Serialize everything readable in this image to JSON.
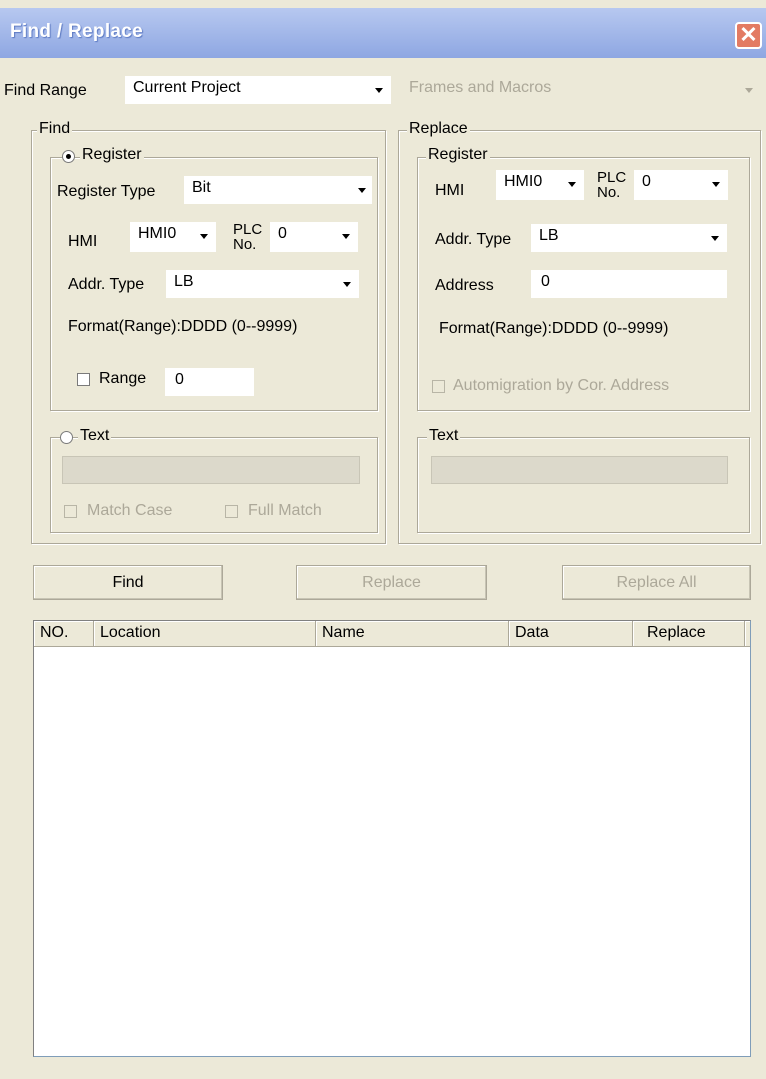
{
  "window": {
    "title": "Find / Replace"
  },
  "find_range": {
    "label": "Find Range",
    "scope": "Current Project",
    "subscope": "Frames and Macros"
  },
  "find": {
    "legend": "Find",
    "register": {
      "option_label": "Register",
      "register_type_label": "Register Type",
      "register_type": "Bit",
      "hmi_label": "HMI",
      "hmi": "HMI0",
      "plc_label_line1": "PLC",
      "plc_label_line2": "No.",
      "plc": "0",
      "addr_type_label": "Addr. Type",
      "addr_type": "LB",
      "format": "Format(Range):DDDD (0--9999)",
      "range_label": "Range",
      "range_value": "0"
    },
    "text": {
      "option_label": "Text",
      "value": "",
      "match_case_label": "Match Case",
      "full_match_label": "Full Match"
    }
  },
  "replace": {
    "legend": "Replace",
    "register": {
      "legend": "Register",
      "hmi_label": "HMI",
      "hmi": "HMI0",
      "plc_label_line1": "PLC",
      "plc_label_line2": "No.",
      "plc": "0",
      "addr_type_label": "Addr. Type",
      "addr_type": "LB",
      "address_label": "Address",
      "address": "0",
      "format": "Format(Range):DDDD (0--9999)",
      "automigration_label": "Automigration by Cor. Address"
    },
    "text": {
      "legend": "Text",
      "value": ""
    }
  },
  "buttons": {
    "find": "Find",
    "replace": "Replace",
    "replace_all": "Replace All"
  },
  "results": {
    "columns": [
      "NO.",
      "Location",
      "Name",
      "Data",
      "Replace"
    ],
    "rows": []
  },
  "colors": {
    "title_bar": "#8ea7e2",
    "close_button": "#e37b63",
    "dialog_face": "#ece9d8",
    "disabled_text": "#aca899"
  }
}
